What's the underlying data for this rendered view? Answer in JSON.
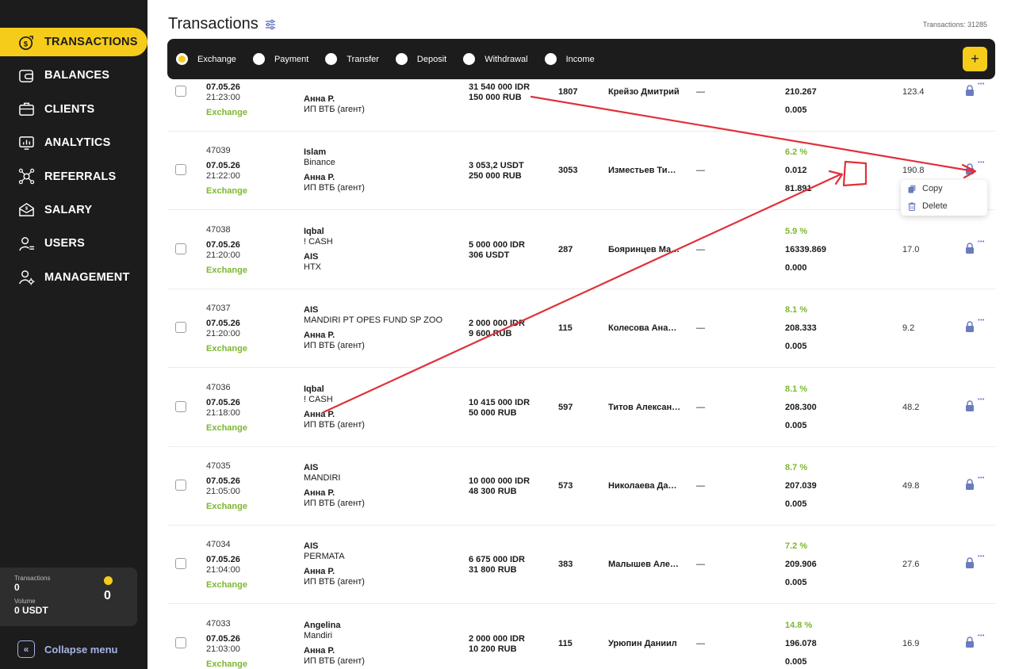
{
  "sidebar": {
    "nav": [
      {
        "label": "TRANSACTIONS",
        "icon": "dollar-bag-icon"
      },
      {
        "label": "BALANCES",
        "icon": "wallet-icon"
      },
      {
        "label": "CLIENTS",
        "icon": "briefcase-icon"
      },
      {
        "label": "ANALYTICS",
        "icon": "chart-monitor-icon"
      },
      {
        "label": "REFERRALS",
        "icon": "referral-network-icon"
      },
      {
        "label": "SALARY",
        "icon": "salary-envelope-icon"
      },
      {
        "label": "USERS",
        "icon": "user-list-icon"
      },
      {
        "label": "MANAGEMENT",
        "icon": "user-gear-icon"
      }
    ],
    "stats": {
      "transactions_label": "Transactions",
      "transactions_value": "0",
      "volume_label": "Volume",
      "volume_value": "0 USDT",
      "big_value": "0"
    },
    "collapse_label": "Collapse menu"
  },
  "header": {
    "title": "Transactions",
    "count": "Transactions: 31285"
  },
  "types": [
    "Exchange",
    "Payment",
    "Transfer",
    "Deposit",
    "Withdrawal",
    "Income"
  ],
  "selected_type": "Exchange",
  "add_label": "+",
  "rows": [
    {
      "id": "",
      "date": "07.05.26",
      "time": "21:23:00",
      "type": "Exchange",
      "from_name": "",
      "from_sub": "",
      "to_name": "Анна Р.",
      "to_sub": "ИП ВТБ (агент)",
      "amt1": "31 540 000 IDR",
      "amt2": "150 000 RUB",
      "num": "1807",
      "client": "Крейзо Дмитрий",
      "dash": "—",
      "pct": "",
      "rate": "210.267",
      "fee": "0.005",
      "val": "123.4"
    },
    {
      "id": "47039",
      "date": "07.05.26",
      "time": "21:22:00",
      "type": "Exchange",
      "from_name": "Islam",
      "from_sub": "Binance",
      "to_name": "Анна Р.",
      "to_sub": "ИП ВТБ (агент)",
      "amt1": "3 053,2 USDT",
      "amt2": "250 000 RUB",
      "num": "3053",
      "client": "Изместьев Тимофей",
      "dash": "—",
      "pct": "6.2 %",
      "rate": "0.012",
      "fee": "81.891",
      "val": "190.8"
    },
    {
      "id": "47038",
      "date": "07.05.26",
      "time": "21:20:00",
      "type": "Exchange",
      "from_name": "Iqbal",
      "from_sub": "! CASH",
      "to_name": "AIS",
      "to_sub": "HTX",
      "amt1": "5 000 000 IDR",
      "amt2": "306 USDT",
      "num": "287",
      "client": "Бояринцев Максим",
      "dash": "—",
      "pct": "5.9 %",
      "rate": "16339.869",
      "fee": "0.000",
      "val": "17.0"
    },
    {
      "id": "47037",
      "date": "07.05.26",
      "time": "21:20:00",
      "type": "Exchange",
      "from_name": "AIS",
      "from_sub": "MANDIRI PT OPES FUND SP ZOO",
      "to_name": "Анна Р.",
      "to_sub": "ИП ВТБ (агент)",
      "amt1": "2 000 000 IDR",
      "amt2": "9 600 RUB",
      "num": "115",
      "client": "Колесова Анастасия",
      "dash": "—",
      "pct": "8.1 %",
      "rate": "208.333",
      "fee": "0.005",
      "val": "9.2"
    },
    {
      "id": "47036",
      "date": "07.05.26",
      "time": "21:18:00",
      "type": "Exchange",
      "from_name": "Iqbal",
      "from_sub": "! CASH",
      "to_name": "Анна Р.",
      "to_sub": "ИП ВТБ (агент)",
      "amt1": "10 415 000 IDR",
      "amt2": "50 000 RUB",
      "num": "597",
      "client": "Титов Александр",
      "dash": "—",
      "pct": "8.1 %",
      "rate": "208.300",
      "fee": "0.005",
      "val": "48.2"
    },
    {
      "id": "47035",
      "date": "07.05.26",
      "time": "21:05:00",
      "type": "Exchange",
      "from_name": "AIS",
      "from_sub": "MANDIRI",
      "to_name": "Анна Р.",
      "to_sub": "ИП ВТБ (агент)",
      "amt1": "10 000 000 IDR",
      "amt2": "48 300 RUB",
      "num": "573",
      "client": "Николаева Дарья",
      "dash": "—",
      "pct": "8.7 %",
      "rate": "207.039",
      "fee": "0.005",
      "val": "49.8"
    },
    {
      "id": "47034",
      "date": "07.05.26",
      "time": "21:04:00",
      "type": "Exchange",
      "from_name": "AIS",
      "from_sub": "PERMATA",
      "to_name": "Анна Р.",
      "to_sub": "ИП ВТБ (агент)",
      "amt1": "6 675 000 IDR",
      "amt2": "31 800 RUB",
      "num": "383",
      "client": "Малышев Алексей",
      "dash": "—",
      "pct": "7.2 %",
      "rate": "209.906",
      "fee": "0.005",
      "val": "27.6"
    },
    {
      "id": "47033",
      "date": "07.05.26",
      "time": "21:03:00",
      "type": "Exchange",
      "from_name": "Angelina",
      "from_sub": "Mandiri",
      "to_name": "Анна Р.",
      "to_sub": "ИП ВТБ (агент)",
      "amt1": "2 000 000 IDR",
      "amt2": "10 200 RUB",
      "num": "115",
      "client": "Урюпин Даниил",
      "dash": "—",
      "pct": "14.8 %",
      "rate": "196.078",
      "fee": "0.005",
      "val": "16.9"
    }
  ],
  "context_menu": {
    "copy": "Copy",
    "delete": "Delete"
  },
  "colors": {
    "accent": "#f6cc1a",
    "sidebar": "#1c1c1c",
    "green": "#7cb82f",
    "annotation": "#e0303a"
  }
}
